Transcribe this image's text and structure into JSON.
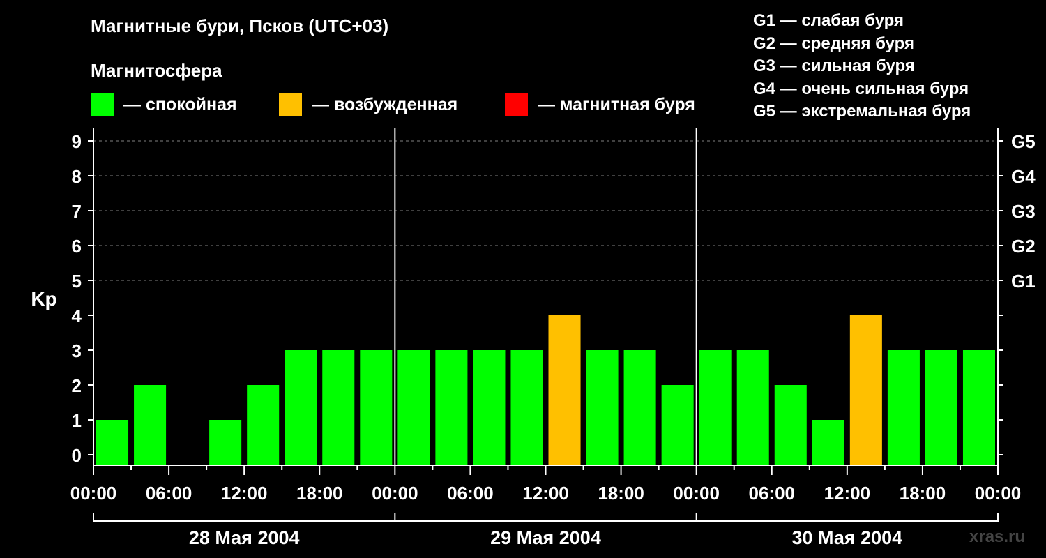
{
  "header": {
    "title": "Магнитные бури, Псков (UTC+03)",
    "subtitle": "Магнитосфера"
  },
  "legend": [
    {
      "label": "— спокойная",
      "color": "#00ff00"
    },
    {
      "label": "— возбужденная",
      "color": "#ffc000"
    },
    {
      "label": "— магнитная буря",
      "color": "#ff0000"
    }
  ],
  "gscale": [
    "G1 — слабая буря",
    "G2 — средняя буря",
    "G3 — сильная буря",
    "G4 — очень сильная буря",
    "G5 — экстремальная буря"
  ],
  "watermark": "xras.ru",
  "chart_data": {
    "type": "bar",
    "ylabel": "Kp",
    "ylim": [
      0,
      9
    ],
    "yticks": [
      0,
      1,
      2,
      3,
      4,
      5,
      6,
      7,
      8,
      9
    ],
    "right_axis_labels": [
      {
        "kp": 5,
        "label": "G1"
      },
      {
        "kp": 6,
        "label": "G2"
      },
      {
        "kp": 7,
        "label": "G3"
      },
      {
        "kp": 8,
        "label": "G4"
      },
      {
        "kp": 9,
        "label": "G5"
      }
    ],
    "grid": "horizontal dashed at Kp 5–9",
    "xtick_labels": [
      "00:00",
      "06:00",
      "12:00",
      "18:00",
      "00:00",
      "06:00",
      "12:00",
      "18:00",
      "00:00",
      "06:00",
      "12:00",
      "18:00",
      "00:00"
    ],
    "days": [
      "28 Мая 2004",
      "29 Мая 2004",
      "30 Мая 2004"
    ],
    "interval_hours": 3,
    "values": [
      1,
      2,
      0,
      1,
      2,
      3,
      3,
      3,
      3,
      3,
      3,
      3,
      4,
      3,
      3,
      2,
      3,
      3,
      2,
      1,
      4,
      3,
      3,
      3
    ],
    "colors": {
      "quiet": "#00ff00",
      "active": "#ffc000",
      "storm": "#ff0000"
    }
  }
}
